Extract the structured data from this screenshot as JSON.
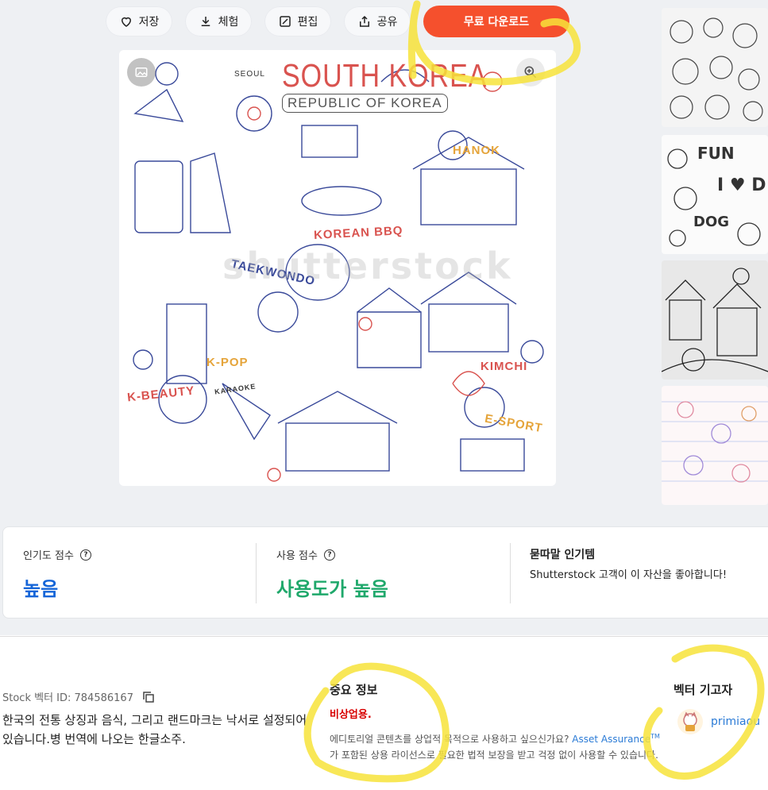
{
  "toolbar": {
    "save_label": "저장",
    "try_label": "체험",
    "edit_label": "편집",
    "share_label": "공유",
    "download_label": "무료 다운로드"
  },
  "main_image": {
    "title": "SOUTH KOREA",
    "subtitle": "REPUBLIC OF KOREA",
    "labels": [
      "SEOUL",
      "HANOK",
      "KOREAN BBQ",
      "TAEKWONDO",
      "K-POP",
      "KIMCHI",
      "K-BEAUTY",
      "E-SPORT",
      "KARAOKE"
    ],
    "watermark": "shutterstock",
    "icons": [
      "image-icon",
      "zoom-icon"
    ]
  },
  "thumbnails": [
    {
      "name": "owls-doodle"
    },
    {
      "name": "fun-i-love-dogs-doodle"
    },
    {
      "name": "houses-doodle"
    },
    {
      "name": "kids-doodle-on-paper"
    }
  ],
  "stats": {
    "popularity_label": "인기도 점수",
    "popularity_value": "높음",
    "usage_label": "사용 점수",
    "usage_value": "사용도가 높음",
    "trending_title": "묻따말 인기템",
    "trending_desc": "Shutterstock 고객이 이 자산을 좋아합니다!"
  },
  "details": {
    "stock_id": "Stock 벡터 ID: 784586167",
    "description": "한국의 전통 상징과 음식, 그리고 랜드마크는 낙서로 설정되어 있습니다.병 번역에 나오는 한글소주.",
    "important_title": "중요 정보",
    "noncommercial": "비상업용.",
    "body_1": "에디토리얼 콘텐츠를 상업적 목적으로 사용하고 싶으신가요? ",
    "asset_link": "Asset Assurance",
    "tm": "TM",
    "body_2": "가 포함된 상용 라이선스로 필요한 법적 보장을 받고 걱정 없이 사용할 수 있습니다.",
    "contributor_title": "벡터 기고자",
    "contributor_name": "primiaou"
  },
  "colors": {
    "accent": "#f5502d",
    "popularity": "#1565d8",
    "usage": "#1fa86b",
    "highlight": "#f7e33a"
  }
}
